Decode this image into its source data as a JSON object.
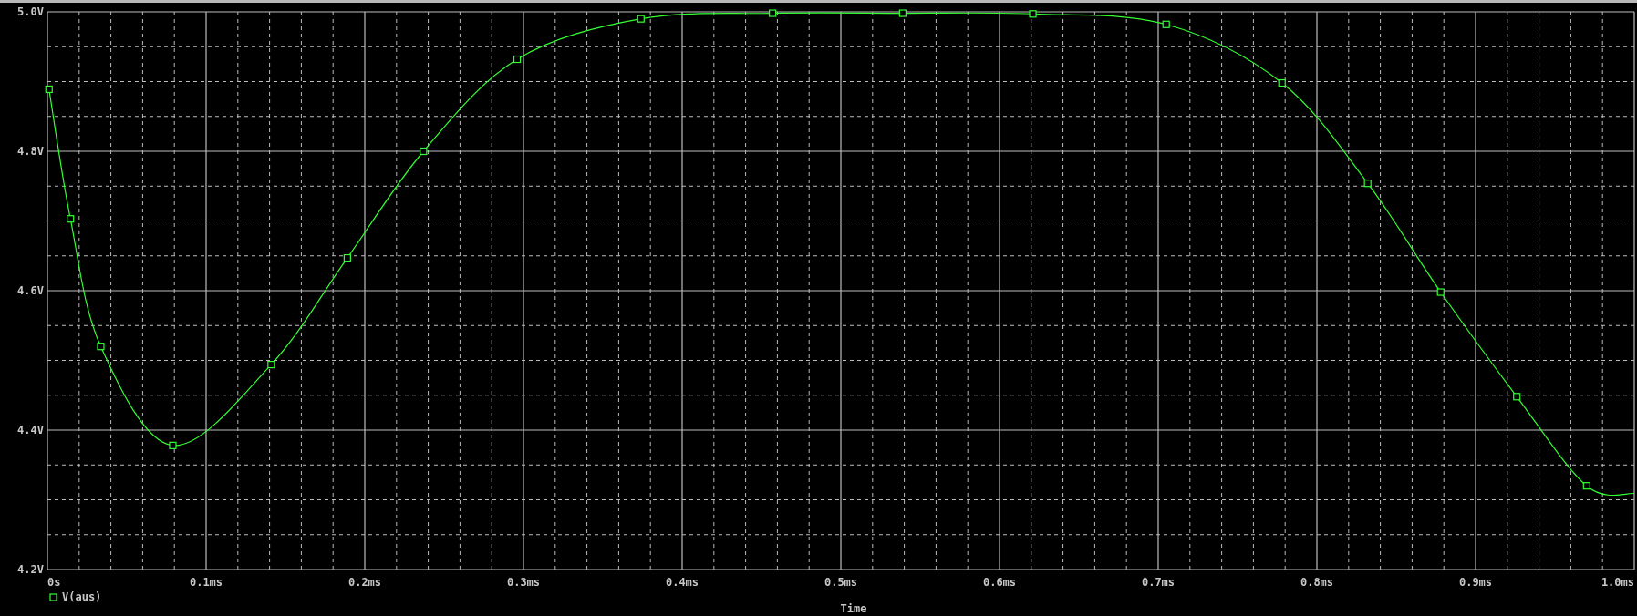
{
  "chart_data": {
    "type": "line",
    "grid": true,
    "xlabel": "Time",
    "xlim": [
      0,
      1
    ],
    "ylim": [
      4.2,
      5.0
    ],
    "xticks": [
      {
        "value": 0,
        "label": "0s"
      },
      {
        "value": 0.1,
        "label": "0.1ms"
      },
      {
        "value": 0.2,
        "label": "0.2ms"
      },
      {
        "value": 0.3,
        "label": "0.3ms"
      },
      {
        "value": 0.4,
        "label": "0.4ms"
      },
      {
        "value": 0.5,
        "label": "0.5ms"
      },
      {
        "value": 0.6,
        "label": "0.6ms"
      },
      {
        "value": 0.7,
        "label": "0.7ms"
      },
      {
        "value": 0.8,
        "label": "0.8ms"
      },
      {
        "value": 0.9,
        "label": "0.9ms"
      },
      {
        "value": 1.0,
        "label": "1.0ms"
      }
    ],
    "yticks": [
      {
        "value": 4.2,
        "label": "4.2V"
      },
      {
        "value": 4.4,
        "label": "4.4V"
      },
      {
        "value": 4.6,
        "label": "4.6V"
      },
      {
        "value": 4.8,
        "label": "4.8V"
      },
      {
        "value": 5.0,
        "label": "5.0V"
      }
    ],
    "x": [
      0.001,
      0.0145,
      0.0336,
      0.079,
      0.141,
      0.189,
      0.237,
      0.296,
      0.374,
      0.457,
      0.539,
      0.621,
      0.705,
      0.778,
      0.832,
      0.878,
      0.926,
      0.97,
      1.0
    ],
    "series": [
      {
        "name": "V(aus)",
        "color": "#33ff33",
        "marker": "square",
        "values": [
          4.889,
          4.703,
          4.52,
          4.378,
          4.494,
          4.647,
          4.8,
          4.932,
          4.99,
          4.998,
          4.998,
          4.997,
          4.982,
          4.898,
          4.754,
          4.598,
          4.448,
          4.32,
          4.309
        ]
      }
    ]
  }
}
